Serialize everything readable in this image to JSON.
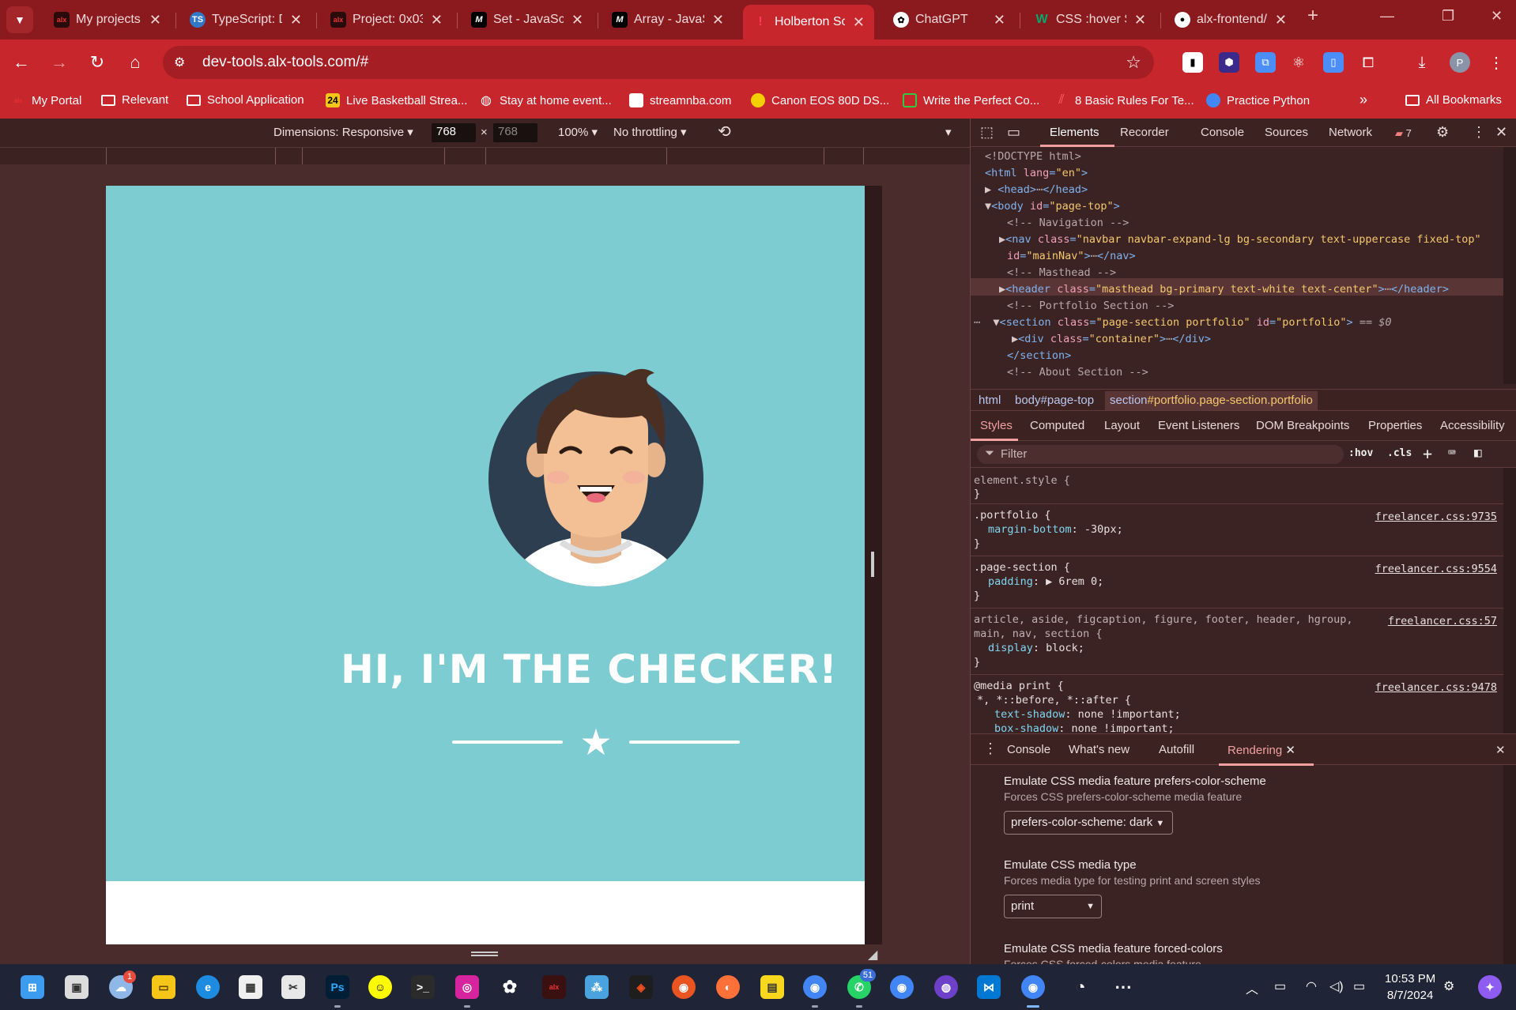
{
  "tabs": [
    {
      "title": "My projects |",
      "icon": "alx-icon",
      "fav_text": "alx"
    },
    {
      "title": "TypeScript: D",
      "icon": "ts-icon",
      "fav_text": "TS"
    },
    {
      "title": "Project: 0x03",
      "icon": "alx-icon",
      "fav_text": "alx"
    },
    {
      "title": "Set - JavaScri",
      "icon": "mdn-icon",
      "fav_text": "M"
    },
    {
      "title": "Array - JavaS",
      "icon": "mdn-icon",
      "fav_text": "M"
    },
    {
      "title": "Holberton Sc",
      "icon": "holberton-icon",
      "fav_text": "!"
    },
    {
      "title": "ChatGPT",
      "icon": "chatgpt-icon",
      "fav_text": "✿"
    },
    {
      "title": "CSS :hover Se",
      "icon": "w3schools-icon",
      "fav_text": "W"
    },
    {
      "title": "alx-frontend/",
      "icon": "github-icon",
      "fav_text": "●"
    }
  ],
  "address": {
    "url": "dev-tools.alx-tools.com/#"
  },
  "bookmarks": [
    {
      "label": "My Portal"
    },
    {
      "label": "Relevant"
    },
    {
      "label": "School Application"
    },
    {
      "label": "Live Basketball Strea..."
    },
    {
      "label": "Stay at home event..."
    },
    {
      "label": "streamnba.com"
    },
    {
      "label": "Canon EOS 80D DS..."
    },
    {
      "label": "Write the Perfect Co..."
    },
    {
      "label": "8 Basic Rules For Te..."
    },
    {
      "label": "Practice Python"
    },
    {
      "label": "All Bookmarks"
    }
  ],
  "device": {
    "dimensions_label": "Dimensions: Responsive",
    "width": "768",
    "height": "768",
    "times": "×",
    "zoom": "100%",
    "throttling": "No throttling"
  },
  "page": {
    "hero_title": "HI, I'M THE CHECKER!",
    "colors": {
      "masthead": "#7cccd1",
      "avatar_bg": "#2c3e50"
    }
  },
  "devtools": {
    "tabs": [
      "Elements",
      "Recorder",
      "Console",
      "Sources",
      "Network"
    ],
    "issues_count": "7",
    "dom": {
      "doctype": "<!DOCTYPE html>",
      "html_tag": "html",
      "html_attr": "lang",
      "html_val": "\"en\"",
      "head_open": "<head>",
      "head_close": "</head>",
      "body_tag": "body",
      "body_attr": "id",
      "body_val": "\"page-top\"",
      "c_nav": "<!-- Navigation -->",
      "nav_tag": "nav",
      "nav_class_val": "\"navbar navbar-expand-lg bg-secondary text-uppercase fixed-top\"",
      "nav_id_val": "\"mainNav\"",
      "nav_close": "</nav>",
      "c_masthead": "<!-- Masthead -->",
      "header_tag": "header",
      "header_class_val": "\"masthead bg-primary text-white text-center\"",
      "header_close": "</header>",
      "c_portfolio": "<!-- Portfolio Section -->",
      "section_tag": "section",
      "section_class_val": "\"page-section portfolio\"",
      "section_id_val": "\"portfolio\"",
      "section_eq": "== $0",
      "div_tag": "div",
      "div_class_val": "\"container\"",
      "div_close": "</div>",
      "section_close": "</section>",
      "c_about": "<!-- About Section -->"
    },
    "breadcrumbs": {
      "html": "html",
      "body": "body#page-top",
      "section_prefix": "section",
      "section_rest": "#portfolio.page-section.portfolio"
    },
    "sub_tabs": [
      "Styles",
      "Computed",
      "Layout",
      "Event Listeners",
      "DOM Breakpoints",
      "Properties",
      "Accessibility"
    ],
    "filter": {
      "placeholder": "Filter",
      "hov": ":hov",
      "cls": ".cls"
    },
    "styles": {
      "r0_sel": "element.style {",
      "r0_end": "}",
      "r1_sel": ".portfolio {",
      "r1_src": "freelancer.css:9735",
      "r1_prop": "margin-bottom",
      "r1_val": ": -30px;",
      "r1_end": "}",
      "r2_sel": ".page-section {",
      "r2_src": "freelancer.css:9554",
      "r2_prop": "padding",
      "r2_val": ": ▶ 6rem 0;",
      "r2_end": "}",
      "r3_sel1": "article, aside, figcaption, figure, footer, header, hgroup,",
      "r3_sel2": "main, nav, section {",
      "r3_src": "freelancer.css:57",
      "r3_prop": "display",
      "r3_val": ": block;",
      "r3_end": "}",
      "r4_sel": "@media print {",
      "r4_src": "freelancer.css:9478",
      "r4_sub": "*, *::before, *::after {",
      "r4_p1": "text-shadow",
      "r4_v1": ": none !important;",
      "r4_p2": "box-shadow",
      "r4_v2": ": none !important;"
    },
    "drawer_tabs": [
      "Console",
      "What's new",
      "Autofill",
      "Rendering"
    ],
    "rendering": {
      "h1": "Emulate CSS media feature prefers-color-scheme",
      "s1": "Forces CSS prefers-color-scheme media feature",
      "sel1": "prefers-color-scheme: dark",
      "h2": "Emulate CSS media type",
      "s2": "Forces media type for testing print and screen styles",
      "sel2": "print",
      "h3": "Emulate CSS media feature forced-colors",
      "s3": "Forces CSS forced-colors media feature"
    }
  },
  "taskbar": {
    "time": "10:53 PM",
    "date": "8/7/2024",
    "weather_badge": "1",
    "whatsapp_badge": "51"
  }
}
